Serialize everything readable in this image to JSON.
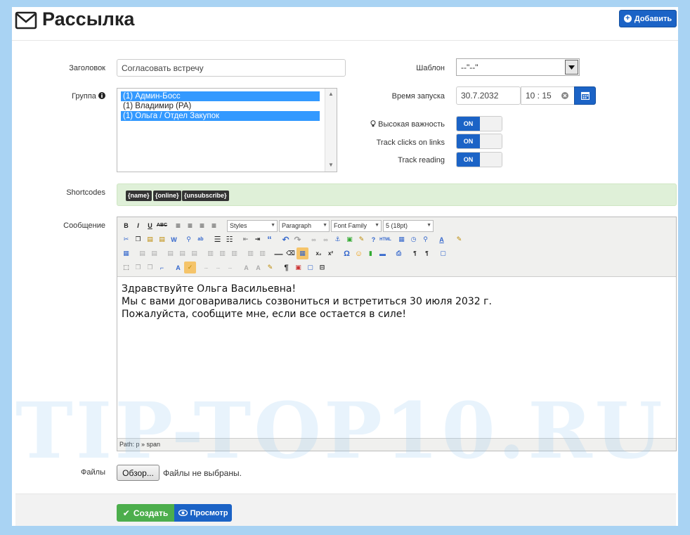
{
  "header": {
    "title": "Рассылка",
    "add_label": "Добавить",
    "icon": "envelope-icon"
  },
  "form": {
    "subject_label": "Заголовок",
    "subject_value": "Согласовать встречу",
    "group_label": "Группа",
    "group_options": [
      {
        "label": "(1) Админ-Босс",
        "selected": true
      },
      {
        "label": "(1) Владимир (PA)",
        "selected": false
      },
      {
        "label": "(1) Ольга / Отдел Закупок",
        "selected": true
      }
    ],
    "template_label": "Шаблон",
    "template_value": "--\"--\"",
    "launch_label": "Время запуска",
    "launch_date": "30.7.2032",
    "launch_time": "10 : 15",
    "high_importance_label": "Высокая важность",
    "track_clicks_label": "Track clicks on links",
    "track_reading_label": "Track reading",
    "toggle_on": "ON",
    "shortcodes_label": "Shortcodes",
    "shortcodes": [
      "{name}",
      "{online}",
      "{unsubscribe}"
    ],
    "message_label": "Сообщение",
    "files_label": "Файлы",
    "browse_label": "Обзор...",
    "no_files": "Файлы не выбраны."
  },
  "editor": {
    "styles": "Styles",
    "paragraph": "Paragraph",
    "font_family": "Font Family",
    "font_size": "5 (18pt)",
    "lines": [
      "Здравствуйте Ольга Васильевна!",
      "Мы с вами договаривались созвониться и встретиться 30 июля 2032 г.",
      "Пожалуйста, сообщите мне, если все остается в силе!"
    ],
    "path": "Path: p » span"
  },
  "footer": {
    "create_label": "Создать",
    "preview_label": "Просмотр"
  },
  "watermark": "TIP-TOP10.RU",
  "colors": {
    "primary": "#1b63c6",
    "success": "#4cae4c",
    "page_bg": "#a9d3f3",
    "shortcode_bg": "#dff0d8"
  }
}
